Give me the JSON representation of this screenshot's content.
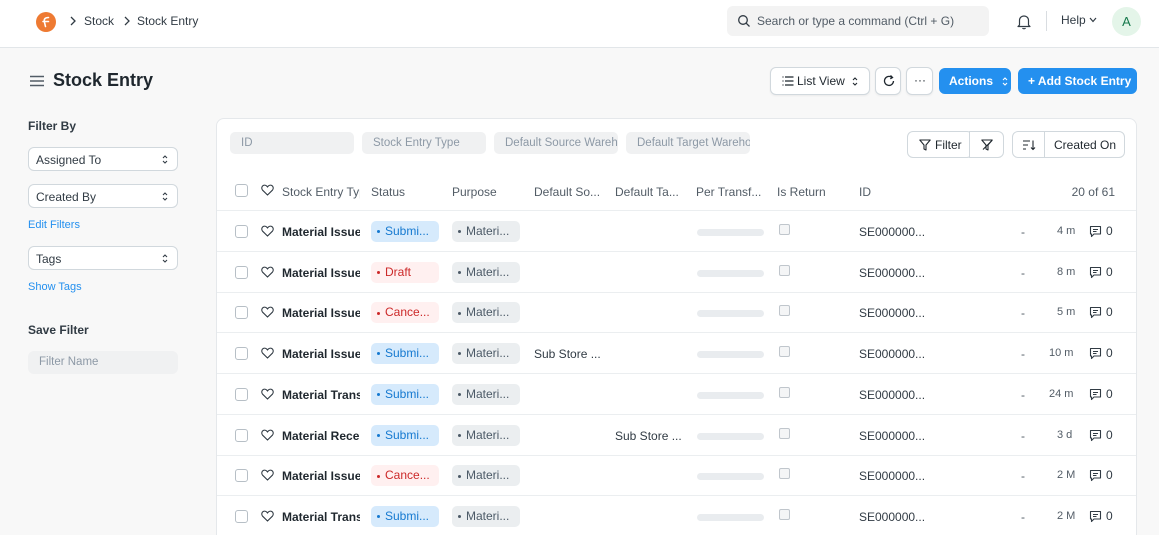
{
  "navbar": {
    "breadcrumb": [
      "Stock",
      "Stock Entry"
    ],
    "search_placeholder": "Search or type a command (Ctrl + G)",
    "help_label": "Help",
    "avatar_letter": "A"
  },
  "page": {
    "title": "Stock Entry",
    "list_view_label": "List View",
    "more_label": "···",
    "actions_label": "Actions",
    "add_label": "+ Add Stock Entry"
  },
  "sidebar": {
    "filter_by_label": "Filter By",
    "assigned_to": "Assigned To",
    "created_by": "Created By",
    "edit_filters": "Edit Filters",
    "tags": "Tags",
    "show_tags": "Show Tags",
    "save_filter_label": "Save Filter",
    "filter_name_placeholder": "Filter Name"
  },
  "filters": {
    "id": "ID",
    "stock_entry_type": "Stock Entry Type",
    "default_source": "Default Source Warehouse",
    "default_target": "Default Target Warehouse",
    "filter_label": "Filter",
    "sort_label": "Created On"
  },
  "table": {
    "columns": [
      "Stock Entry Type",
      "Status",
      "Purpose",
      "Default So...",
      "Default Ta...",
      "Per Transf...",
      "Is Return",
      "ID"
    ],
    "count": "20 of 61",
    "rows": [
      {
        "title": "Material Issue",
        "status": "Submi...",
        "status_kind": "blue",
        "purpose": "Materi...",
        "source": "",
        "target": "",
        "progress": 0,
        "id": "SE000000...",
        "dash": "-",
        "time": "4 m",
        "comments": "0"
      },
      {
        "title": "Material Issue",
        "status": "Draft",
        "status_kind": "red",
        "purpose": "Materi...",
        "source": "",
        "target": "",
        "progress": 0,
        "id": "SE000000...",
        "dash": "-",
        "time": "8 m",
        "comments": "0"
      },
      {
        "title": "Material Issue",
        "status": "Cance...",
        "status_kind": "red",
        "purpose": "Materi...",
        "source": "",
        "target": "",
        "progress": 0,
        "id": "SE000000...",
        "dash": "-",
        "time": "5 m",
        "comments": "0"
      },
      {
        "title": "Material Issue",
        "status": "Submi...",
        "status_kind": "blue",
        "purpose": "Materi...",
        "source": "Sub Store ...",
        "target": "",
        "progress": 0,
        "id": "SE000000...",
        "dash": "-",
        "time": "10 m",
        "comments": "0"
      },
      {
        "title": "Material Transfer",
        "status": "Submi...",
        "status_kind": "blue",
        "purpose": "Materi...",
        "source": "",
        "target": "",
        "progress": 0,
        "id": "SE000000...",
        "dash": "-",
        "time": "24 m",
        "comments": "0"
      },
      {
        "title": "Material Receipt",
        "status": "Submi...",
        "status_kind": "blue",
        "purpose": "Materi...",
        "source": "",
        "target": "Sub Store ...",
        "progress": 0,
        "id": "SE000000...",
        "dash": "-",
        "time": "3 d",
        "comments": "0"
      },
      {
        "title": "Material Issue",
        "status": "Cance...",
        "status_kind": "red",
        "purpose": "Materi...",
        "source": "",
        "target": "",
        "progress": 0,
        "id": "SE000000...",
        "dash": "-",
        "time": "2 M",
        "comments": "0"
      },
      {
        "title": "Material Transfer",
        "status": "Submi...",
        "status_kind": "blue",
        "purpose": "Materi...",
        "source": "",
        "target": "",
        "progress": 0,
        "id": "SE000000...",
        "dash": "-",
        "time": "2 M",
        "comments": "0"
      }
    ]
  },
  "colors": {
    "primary": "#2490ef",
    "logo": "#ee7a32",
    "status_blue_bg": "#d6eafc",
    "status_red_bg": "#fff0f0"
  }
}
